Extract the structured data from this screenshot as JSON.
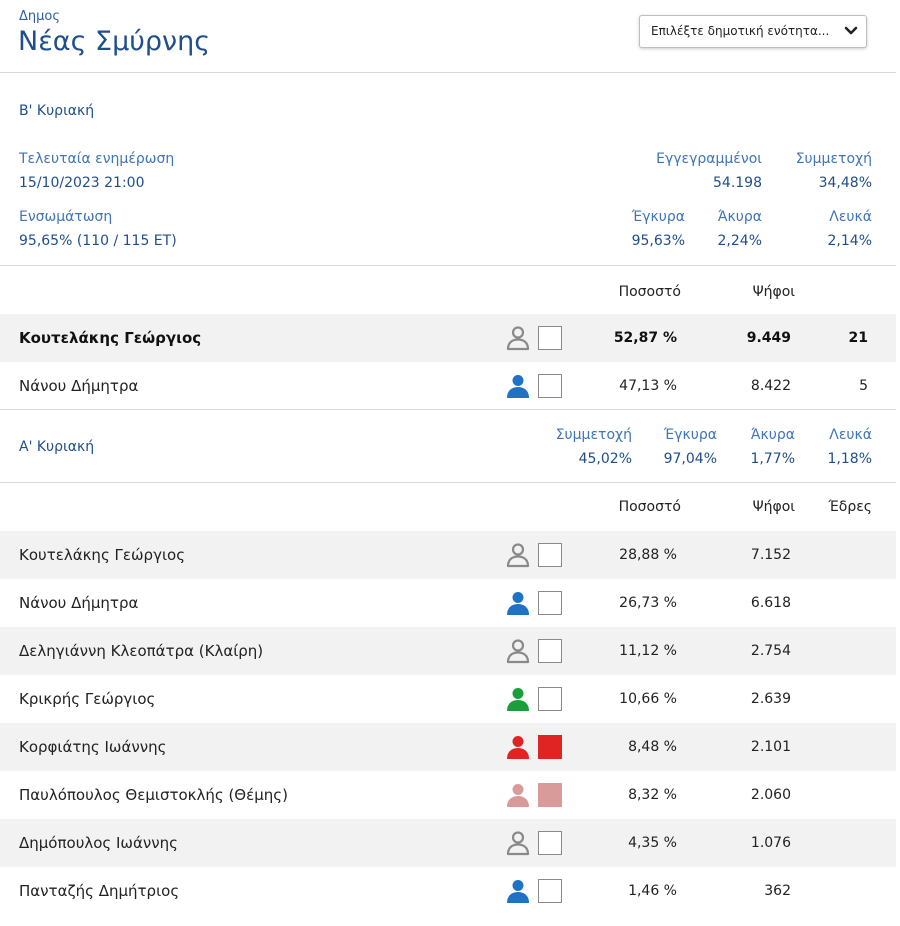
{
  "header": {
    "label": "Δημος",
    "name": "Νέας Σμύρνης",
    "select_value": "Επιλέξτε δημοτική ενότητα..."
  },
  "round2": {
    "title": "Β' Κυριακή",
    "last_update_label": "Τελευταία ενημέρωση",
    "last_update": "15/10/2023 21:00",
    "registered_label": "Εγγεγραμμένοι",
    "registered": "54.198",
    "turnout_label": "Συμμετοχή",
    "turnout": "34,48%",
    "integration_label": "Ενσωμάτωση",
    "integration": "95,65% (110 / 115 ΕΤ)",
    "valid_label": "Έγκυρα",
    "valid": "95,63%",
    "invalid_label": "Άκυρα",
    "invalid": "2,24%",
    "blank_label": "Λευκά",
    "blank": "2,14%",
    "col_percent": "Ποσοστό",
    "col_votes": "Ψήφοι",
    "candidates": [
      {
        "name": "Κουτελάκης Γεώργιος",
        "percent": "52,87 %",
        "votes": "9.449",
        "seats": "21",
        "icon_color": "#8a8a8a",
        "outline": true,
        "box_color": "#ffffff",
        "box_filled": false
      },
      {
        "name": "Νάνου Δήμητρα",
        "percent": "47,13 %",
        "votes": "8.422",
        "seats": "5",
        "icon_color": "#1f72c4",
        "outline": false,
        "box_color": "#ffffff",
        "box_filled": false
      }
    ]
  },
  "round1": {
    "title": "Α' Κυριακή",
    "turnout_label": "Συμμετοχή",
    "turnout": "45,02%",
    "valid_label": "Έγκυρα",
    "valid": "97,04%",
    "invalid_label": "Άκυρα",
    "invalid": "1,77%",
    "blank_label": "Λευκά",
    "blank": "1,18%",
    "col_percent": "Ποσοστό",
    "col_votes": "Ψήφοι",
    "col_seats": "Έδρες",
    "candidates": [
      {
        "name": "Κουτελάκης Γεώργιος",
        "percent": "28,88 %",
        "votes": "7.152",
        "icon_color": "#8a8a8a",
        "outline": true,
        "box_color": "#ffffff",
        "box_filled": false
      },
      {
        "name": "Νάνου Δήμητρα",
        "percent": "26,73 %",
        "votes": "6.618",
        "icon_color": "#1f72c4",
        "outline": false,
        "box_color": "#ffffff",
        "box_filled": false
      },
      {
        "name": "Δεληγιάννη Κλεοπάτρα (Κλαίρη)",
        "percent": "11,12 %",
        "votes": "2.754",
        "icon_color": "#8a8a8a",
        "outline": true,
        "box_color": "#ffffff",
        "box_filled": false
      },
      {
        "name": "Κρικρής Γεώργιος",
        "percent": "10,66 %",
        "votes": "2.639",
        "icon_color": "#1a9e3a",
        "outline": false,
        "box_color": "#ffffff",
        "box_filled": false
      },
      {
        "name": "Κορφιάτης Ιωάννης",
        "percent": "8,48 %",
        "votes": "2.101",
        "icon_color": "#e02424",
        "outline": false,
        "box_color": "#e02424",
        "box_filled": true
      },
      {
        "name": "Παυλόπουλος Θεμιστοκλής (Θέμης)",
        "percent": "8,32 %",
        "votes": "2.060",
        "icon_color": "#d99a9a",
        "outline": false,
        "box_color": "#d99a9a",
        "box_filled": true
      },
      {
        "name": "Δημόπουλος Ιωάννης",
        "percent": "4,35 %",
        "votes": "1.076",
        "icon_color": "#8a8a8a",
        "outline": true,
        "box_color": "#ffffff",
        "box_filled": false
      },
      {
        "name": "Πανταζής Δημήτριος",
        "percent": "1,46 %",
        "votes": "362",
        "icon_color": "#1f72c4",
        "outline": false,
        "box_color": "#ffffff",
        "box_filled": false
      }
    ]
  }
}
